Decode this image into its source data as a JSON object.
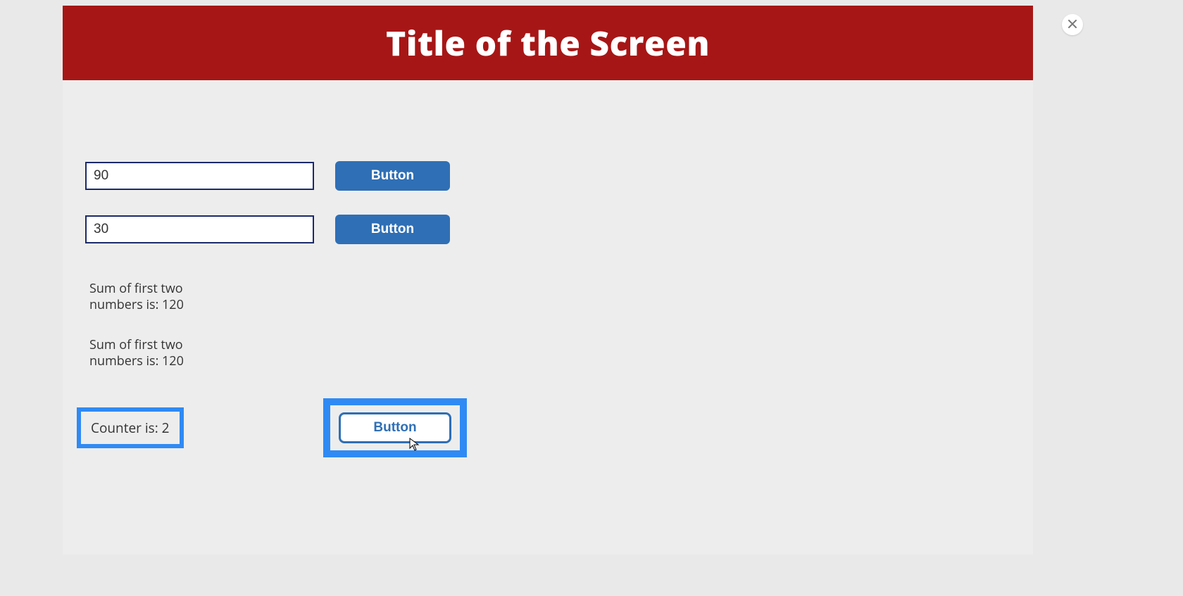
{
  "header": {
    "title": "Title of the Screen"
  },
  "inputs": {
    "first": {
      "value": "90"
    },
    "second": {
      "value": "30"
    }
  },
  "buttons": {
    "btn1": "Button",
    "btn2": "Button",
    "btn3": "Button"
  },
  "labels": {
    "sum1": "Sum of first two numbers is: 120",
    "sum2": "Sum of first two numbers is: 120",
    "counter": "Counter is: 2"
  }
}
